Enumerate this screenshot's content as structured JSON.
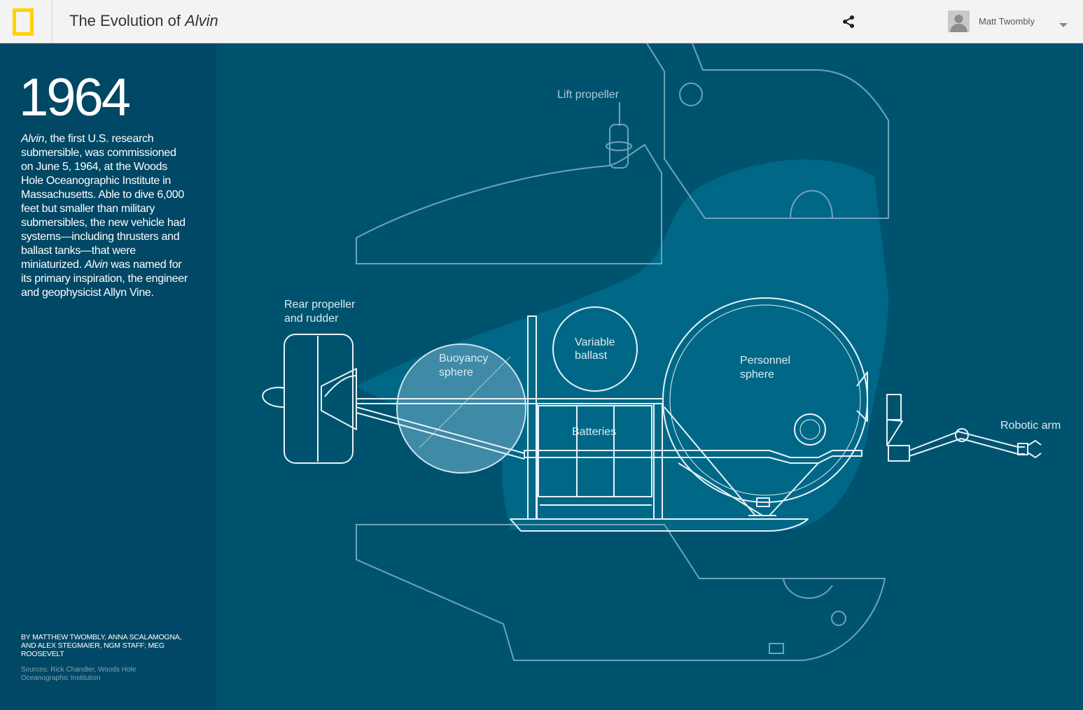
{
  "header": {
    "title_prefix": "The Evolution of ",
    "title_italic": "Alvin",
    "user_name": "Matt Twombly"
  },
  "sidebar": {
    "year": "1964",
    "desc_em1": "Alvin",
    "desc_part1": ", the first U.S. research submersible, was commissioned on June 5, 1964, at the Woods Hole Oceanographic Institute in Massachusetts. Able to dive 6,000 feet but smaller than military submersibles, the new vehicle had systems—including thrusters and ballast tanks—that were miniaturized. ",
    "desc_em2": "Alvin",
    "desc_part2": " was named for its primary inspiration, the engineer and geophysicist Allyn Vine.",
    "byline": "By Matthew Twombly, Anna Scalamogna, and Alex Stegmaier, NGM Staff; Meg Roosevelt",
    "sources": "Sources: Rick Chandler, Woods Hole Oceanographic Institution"
  },
  "diagram": {
    "labels": {
      "lift_propeller": "Lift propeller",
      "rear_propeller_1": "Rear propeller",
      "rear_propeller_2": "and rudder",
      "buoyancy_1": "Buoyancy",
      "buoyancy_2": "sphere",
      "variable_1": "Variable",
      "variable_2": "ballast",
      "personnel_1": "Personnel",
      "personnel_2": "sphere",
      "batteries": "Batteries",
      "robotic_arm": "Robotic arm"
    }
  },
  "icons": [
    "logo-icon",
    "share-icon",
    "avatar-icon",
    "chevron-down-icon"
  ],
  "colors": {
    "logo_yellow": "#ffd200",
    "sidebar_bg": "#004865",
    "diagram_bg": "#00536f",
    "hull_fill": "#006b8c",
    "line": "#e6f3f8"
  }
}
